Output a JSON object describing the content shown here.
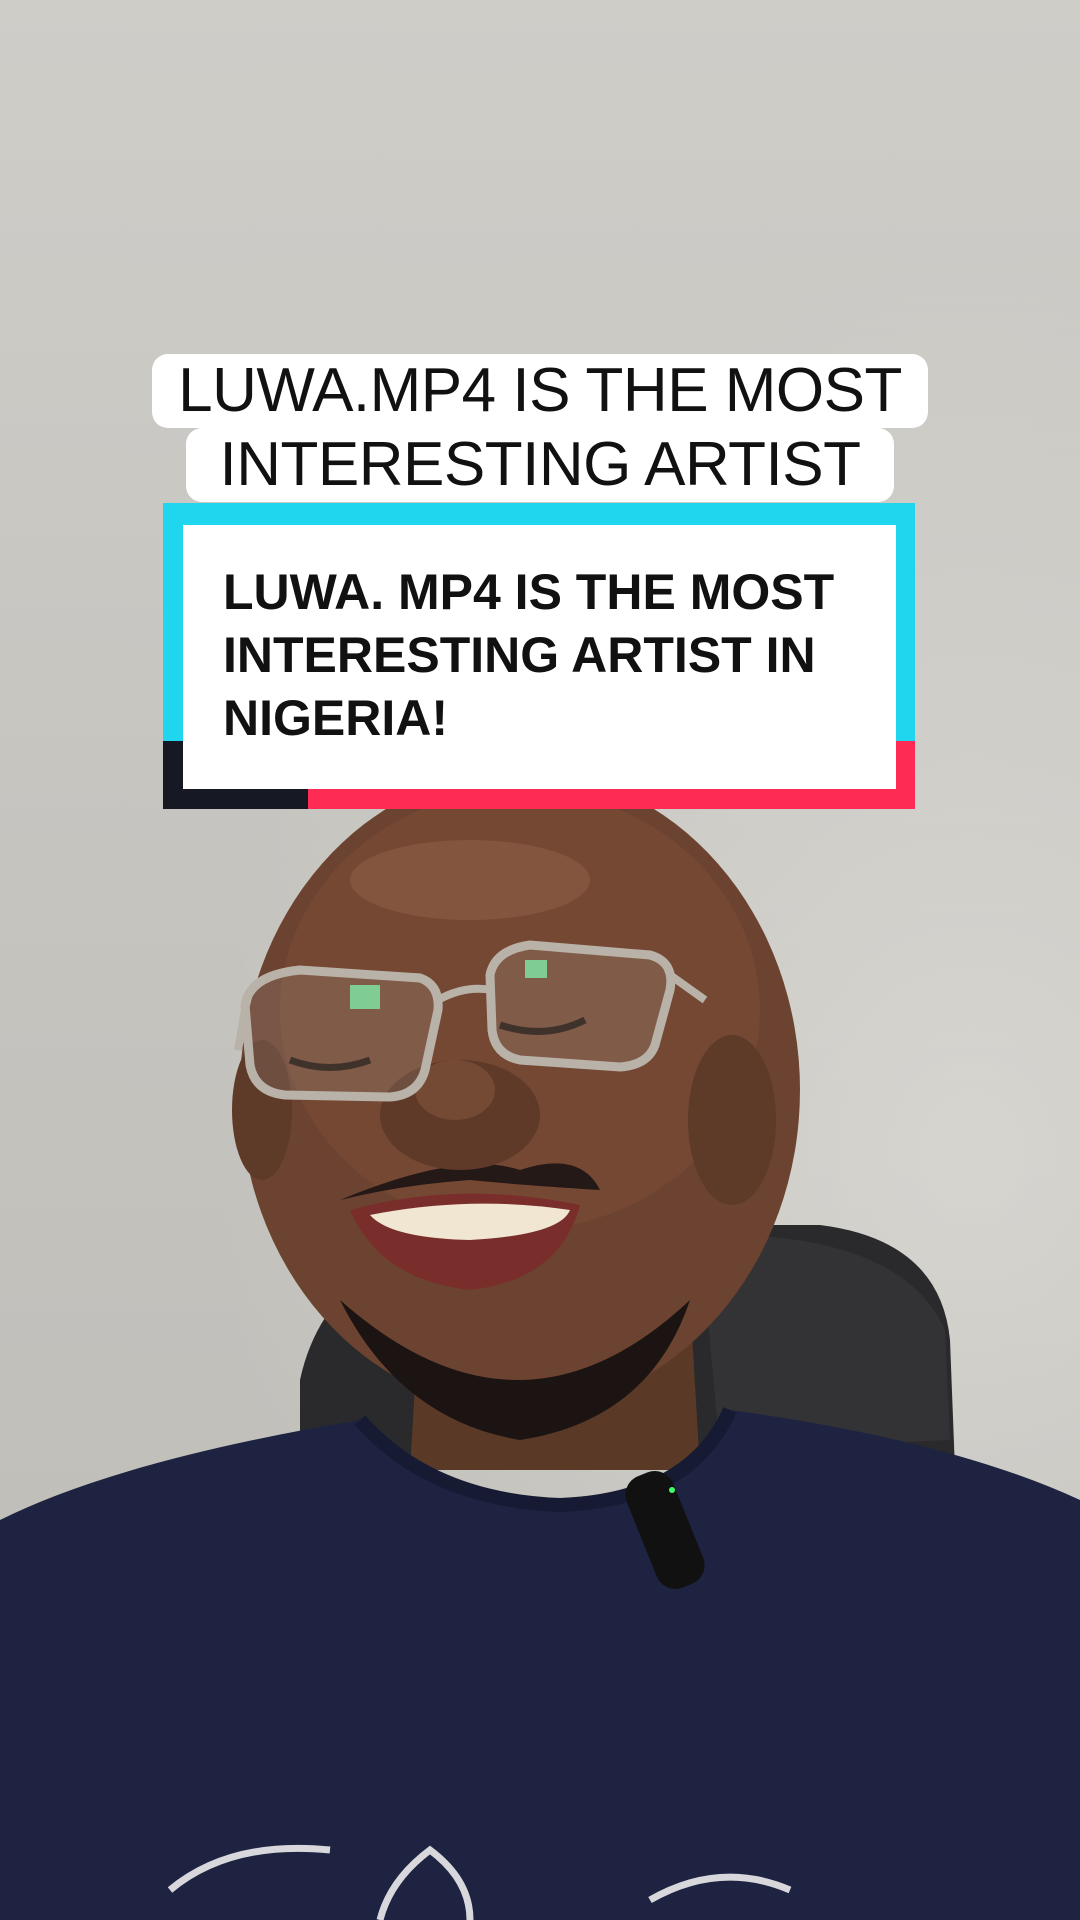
{
  "caption": {
    "line1": "LUWA.MP4 IS THE MOST",
    "line2": "INTERESTING ARTIST"
  },
  "card": {
    "text": "LUWA. MP4 IS THE MOST INTERESTING ARTIST IN NIGERIA!",
    "colors": {
      "accent_cyan": "#20d6ee",
      "accent_red": "#fe2c55",
      "accent_dark": "#161823"
    }
  }
}
